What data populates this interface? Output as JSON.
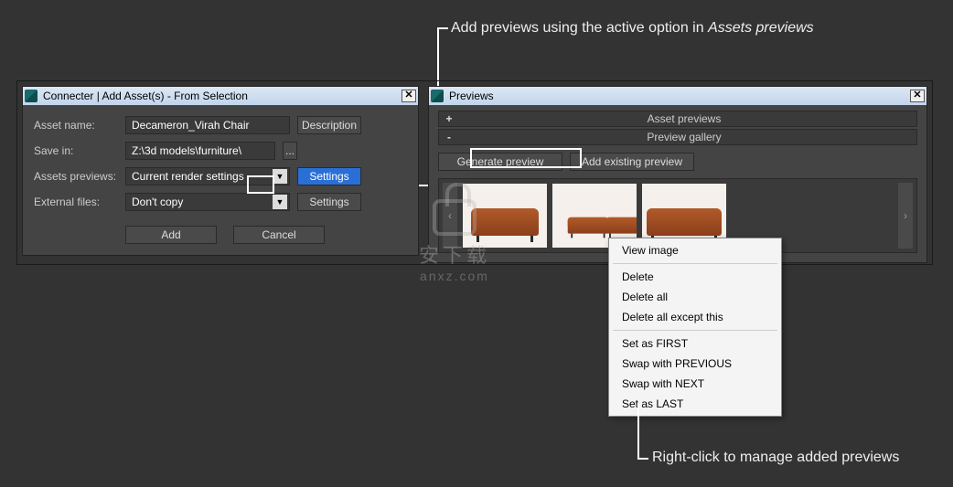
{
  "annotations": {
    "top_prefix": "Add previews using the active option in ",
    "top_em": "Assets previews",
    "bottom": "Right-click to manage added previews"
  },
  "left_window": {
    "title": "Connecter | Add Asset(s) - From Selection",
    "form": {
      "asset_name_label": "Asset name:",
      "asset_name_value": "Decameron_Virah Chair",
      "description_btn": "Description",
      "save_in_label": "Save in:",
      "save_in_value": "Z:\\3d models\\furniture\\",
      "browse_btn": "...",
      "assets_previews_label": "Assets previews:",
      "assets_previews_value": "Current render settings",
      "settings_btn1": "Settings",
      "external_files_label": "External files:",
      "external_files_value": "Don't copy",
      "settings_btn2": "Settings",
      "add_btn": "Add",
      "cancel_btn": "Cancel"
    }
  },
  "right_window": {
    "title": "Previews",
    "sections": {
      "asset_previews": "Asset previews",
      "preview_gallery": "Preview gallery"
    },
    "toolbar": {
      "generate": "Generate preview",
      "add_existing": "Add existing preview"
    }
  },
  "context_menu": {
    "view_image": "View image",
    "delete": "Delete",
    "delete_all": "Delete all",
    "delete_all_except": "Delete all except this",
    "set_first": "Set as FIRST",
    "swap_prev": "Swap with PREVIOUS",
    "swap_next": "Swap with NEXT",
    "set_last": "Set as LAST"
  },
  "watermark": {
    "line1": "安下载",
    "line2": "anxz.com"
  }
}
